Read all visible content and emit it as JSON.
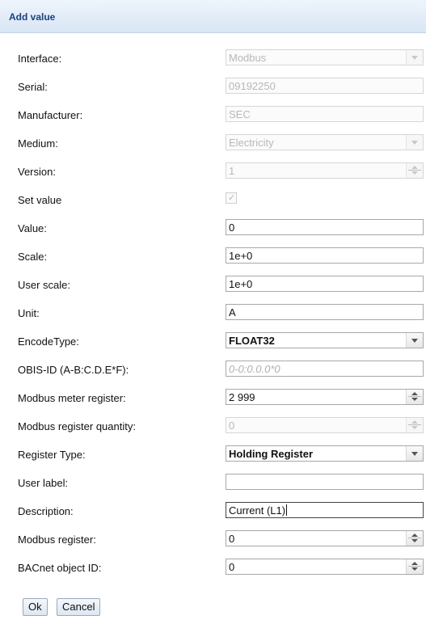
{
  "dialog": {
    "title": "Add value"
  },
  "fields": {
    "interface": {
      "label": "Interface:",
      "value": "Modbus"
    },
    "serial": {
      "label": "Serial:",
      "value": "09192250"
    },
    "manufacturer": {
      "label": "Manufacturer:",
      "value": "SEC"
    },
    "medium": {
      "label": "Medium:",
      "value": "Electricity"
    },
    "version": {
      "label": "Version:",
      "value": "1"
    },
    "set_value": {
      "label": "Set value",
      "checked": true
    },
    "value": {
      "label": "Value:",
      "value": "0"
    },
    "scale": {
      "label": "Scale:",
      "value": "1e+0"
    },
    "user_scale": {
      "label": "User scale:",
      "value": "1e+0"
    },
    "unit": {
      "label": "Unit:",
      "value": "A"
    },
    "encode_type": {
      "label": "EncodeType:",
      "value": "FLOAT32"
    },
    "obis_id": {
      "label": "OBIS-ID (A-B:C.D.E*F):",
      "placeholder": "0-0:0.0.0*0"
    },
    "modbus_meter_register": {
      "label": "Modbus meter register:",
      "value": "2 999"
    },
    "modbus_register_quantity": {
      "label": "Modbus register quantity:",
      "value": "0"
    },
    "register_type": {
      "label": "Register Type:",
      "value": "Holding Register"
    },
    "user_label": {
      "label": "User label:",
      "value": ""
    },
    "description": {
      "label": "Description:",
      "value": "Current (L1)"
    },
    "modbus_register": {
      "label": "Modbus register:",
      "value": "0"
    },
    "bacnet_object_id": {
      "label": "BACnet object ID:",
      "value": "0"
    }
  },
  "buttons": {
    "ok": "Ok",
    "cancel": "Cancel"
  },
  "icons": {
    "dropdown": "chevron-down-icon",
    "spinner": "spinner-arrows-icon",
    "checkbox": "checkmark-icon"
  }
}
